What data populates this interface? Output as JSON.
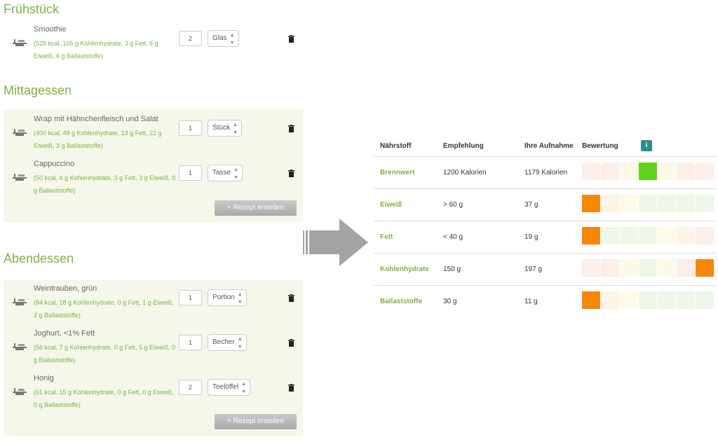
{
  "meals": {
    "breakfast": {
      "title": "Frühstück",
      "items": [
        {
          "name": "Smoothie",
          "info": "(528 kcal, 105 g Kohlenhydrate, 3 g Fett, 6 g Eiweiß, 6 g Ballaststoffe)",
          "qty": "2",
          "unit": "Glas"
        }
      ]
    },
    "lunch": {
      "title": "Mittagessen",
      "items": [
        {
          "name": "Wrap mit Hähnchenfleisch und Salat",
          "info": "(400 kcal, 48 g Kohlenhydrate, 13 g Fett, 22 g Eiweiß, 3 g Ballaststoffe)",
          "qty": "1",
          "unit": "Stück"
        },
        {
          "name": "Cappuccino",
          "info": "(50 kcal, 4 g Kohlenhydrate, 3 g Fett, 3 g Eiweiß, 0 g Ballaststoffe)",
          "qty": "1",
          "unit": "Tasse"
        }
      ],
      "button": "+ Rezept erstellen"
    },
    "dinner": {
      "title": "Abendessen",
      "items": [
        {
          "name": "Weintrauben, grün",
          "info": "(84 kcal, 18 g Kohlenhydrate, 0 g Fett, 1 g Eiweiß, 2 g Ballaststoffe)",
          "qty": "1",
          "unit": "Portion"
        },
        {
          "name": "Joghurt, <1% Fett",
          "info": "(56 kcal, 7 g Kohlenhydrate, 0 g Fett, 5 g Eiweiß, 0 g Ballaststoffe)",
          "qty": "1",
          "unit": "Becher"
        },
        {
          "name": "Honig",
          "info": "(61 kcal, 15 g Kohlenhydrate, 0 g Fett, 0 g Eiweiß, 0 g Ballaststoffe)",
          "qty": "2",
          "unit": "Teelöffel"
        }
      ],
      "button": "+ Rezept erstellen"
    }
  },
  "nutrition_table": {
    "headers": {
      "nutrient": "Nährstoff",
      "recommendation": "Empfehlung",
      "intake": "Ihre Aufnahme",
      "rating": "Bewertung",
      "info": "i"
    },
    "rows": [
      {
        "nutrient": "Brennwert",
        "recommendation": "1200 Kalorien",
        "intake": "1179 Kalorien",
        "rating_segment": 4,
        "rating_color": "#5fd21a"
      },
      {
        "nutrient": "Eiweiß",
        "recommendation": "> 60 g",
        "intake": "37 g",
        "rating_segment": 1,
        "rating_color": "#f5870a"
      },
      {
        "nutrient": "Fett",
        "recommendation": "< 40 g",
        "intake": "19 g",
        "rating_segment": 1,
        "rating_color": "#f5870a"
      },
      {
        "nutrient": "Kohlenhydrate",
        "recommendation": "150 g",
        "intake": "197 g",
        "rating_segment": 7,
        "rating_color": "#f5870a"
      },
      {
        "nutrient": "Ballaststoffe",
        "recommendation": "30 g",
        "intake": "11 g",
        "rating_segment": 1,
        "rating_color": "#f5870a"
      }
    ],
    "segment_colors_range": [
      "#fdeee8",
      "#fdeee8",
      "#fdf8e8",
      "#eef8ea",
      "#fdf8e8",
      "#fdeee8",
      "#fdeee8"
    ],
    "segment_colors_min": [
      "#fdeee8",
      "#fdf3e8",
      "#fdfbe8",
      "#eef8ea",
      "#eef8ea",
      "#eef8ea",
      "#eef8ea"
    ],
    "segment_colors_max": [
      "#eef8ea",
      "#eef8ea",
      "#eef8ea",
      "#eef8ea",
      "#fdfbe8",
      "#fdf3e8",
      "#fdeee8"
    ],
    "row_palettes": [
      "range",
      "min",
      "max",
      "range",
      "min"
    ]
  },
  "colors": {
    "accent_green": "#7cb342",
    "rating_good": "#5fd21a",
    "rating_bad": "#f5870a",
    "info_badge": "#2e8b8b"
  }
}
